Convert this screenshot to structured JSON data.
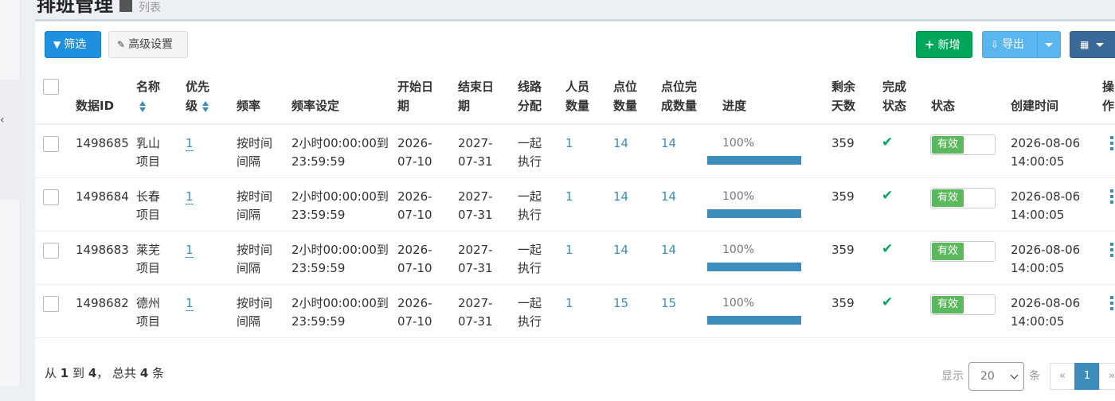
{
  "page": {
    "title": "排班管理",
    "subtitle": "列表"
  },
  "toolbar": {
    "filter_label": "筛选",
    "advanced_label": "高级设置",
    "add_label": "新增",
    "export_label": "导出"
  },
  "table": {
    "headers": {
      "id": "数据ID",
      "name": "名称",
      "priority_l1": "优先",
      "priority_l2": "级",
      "freq": "频率",
      "freq_setting": "频率设定",
      "start_l1": "开始日",
      "start_l2": "期",
      "end_l1": "结束日",
      "end_l2": "期",
      "route_l1": "线路",
      "route_l2": "分配",
      "people_l1": "人员",
      "people_l2": "数量",
      "points_l1": "点位",
      "points_l2": "数量",
      "done_l1": "点位完",
      "done_l2": "成数量",
      "progress": "进度",
      "remain_l1": "剩余",
      "remain_l2": "天数",
      "complete_l1": "完成",
      "complete_l2": "状态",
      "status": "状态",
      "created": "创建时间",
      "op_l1": "操",
      "op_l2": "作"
    },
    "rows": [
      {
        "id": "1498685",
        "name_l1": "乳山",
        "name_l2": "项目",
        "priority": "1",
        "freq_l1": "按时间",
        "freq_l2": "间隔",
        "fs_l1": "2小时00:00:00到",
        "fs_l2": "23:59:59",
        "start_l1": "2026-",
        "start_l2": "07-10",
        "end_l1": "2027-",
        "end_l2": "07-31",
        "route_l1": "一起",
        "route_l2": "执行",
        "people": "1",
        "points": "14",
        "done": "14",
        "progress_text": "100%",
        "progress": 1.0,
        "remain": "359",
        "status": "有效",
        "created_l1": "2026-08-06",
        "created_l2": "14:00:05"
      },
      {
        "id": "1498684",
        "name_l1": "长春",
        "name_l2": "项目",
        "priority": "1",
        "freq_l1": "按时间",
        "freq_l2": "间隔",
        "fs_l1": "2小时00:00:00到",
        "fs_l2": "23:59:59",
        "start_l1": "2026-",
        "start_l2": "07-10",
        "end_l1": "2027-",
        "end_l2": "07-31",
        "route_l1": "一起",
        "route_l2": "执行",
        "people": "1",
        "points": "14",
        "done": "14",
        "progress_text": "100%",
        "progress": 1.0,
        "remain": "359",
        "status": "有效",
        "created_l1": "2026-08-06",
        "created_l2": "14:00:05"
      },
      {
        "id": "1498683",
        "name_l1": "莱芜",
        "name_l2": "项目",
        "priority": "1",
        "freq_l1": "按时间",
        "freq_l2": "间隔",
        "fs_l1": "2小时00:00:00到",
        "fs_l2": "23:59:59",
        "start_l1": "2026-",
        "start_l2": "07-10",
        "end_l1": "2027-",
        "end_l2": "07-31",
        "route_l1": "一起",
        "route_l2": "执行",
        "people": "1",
        "points": "14",
        "done": "14",
        "progress_text": "100%",
        "progress": 1.0,
        "remain": "359",
        "status": "有效",
        "created_l1": "2026-08-06",
        "created_l2": "14:00:05"
      },
      {
        "id": "1498682",
        "name_l1": "德州",
        "name_l2": "项目",
        "priority": "1",
        "freq_l1": "按时间",
        "freq_l2": "间隔",
        "fs_l1": "2小时00:00:00到",
        "fs_l2": "23:59:59",
        "start_l1": "2026-",
        "start_l2": "07-10",
        "end_l1": "2027-",
        "end_l2": "07-31",
        "route_l1": "一起",
        "route_l2": "执行",
        "people": "1",
        "points": "15",
        "done": "15",
        "progress_text": "100%",
        "progress": 1.0,
        "remain": "359",
        "status": "有效",
        "created_l1": "2026-08-06",
        "created_l2": "14:00:05"
      }
    ]
  },
  "footer": {
    "summary_a": "从",
    "summary_from": "1",
    "summary_b": "到",
    "summary_to": "4",
    "summary_c": "，  总共",
    "summary_total": "4",
    "summary_d": "条",
    "show_label": "显示",
    "page_size": "20",
    "per_label": "条",
    "prev": "«",
    "current_page": "1",
    "next": "»"
  },
  "colors": {
    "primary": "#1f8fe0",
    "success": "#00a65a",
    "info": "#5bb6f0",
    "link": "#3c8dbc",
    "status_on": "#5cb85c"
  }
}
